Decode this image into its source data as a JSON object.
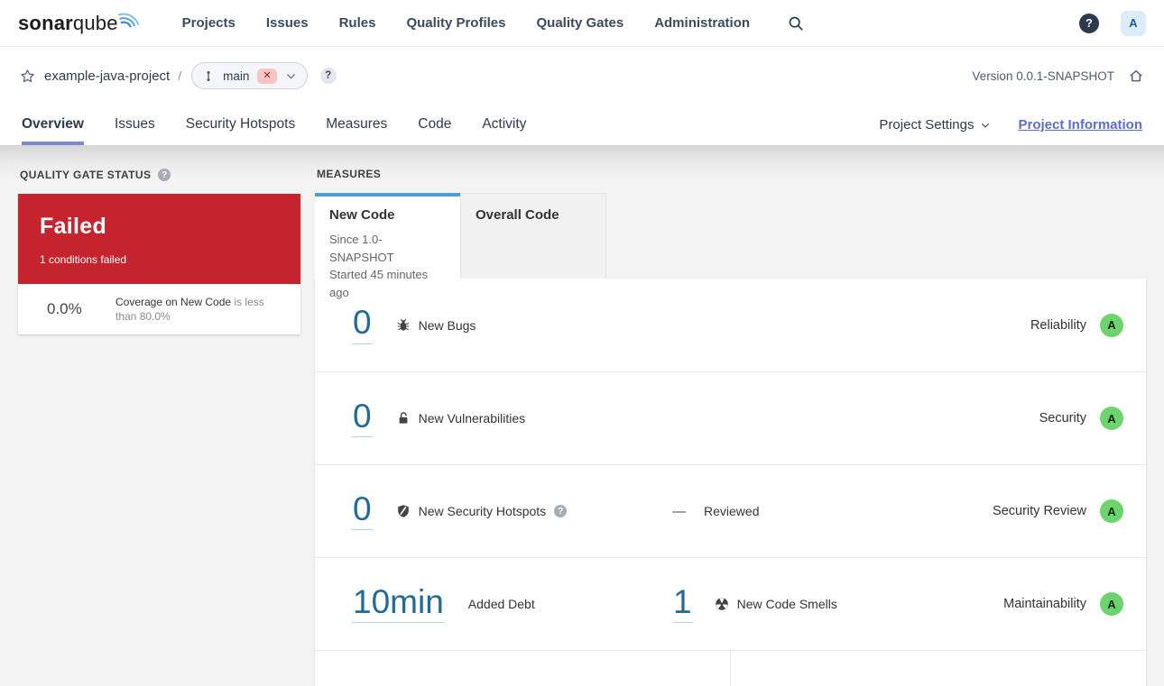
{
  "colors": {
    "accent_blue": "#4b9fd5",
    "link_blue": "#236a97",
    "failed_red": "#c5242e",
    "rating_a_green": "#6cd46c",
    "tab_underline": "#7b88d8",
    "project_info_link": "#5d6cd2"
  },
  "nav": {
    "logo_bold": "sonar",
    "logo_light": "qube",
    "items": [
      "Projects",
      "Issues",
      "Rules",
      "Quality Profiles",
      "Quality Gates",
      "Administration"
    ],
    "help_glyph": "?",
    "avatar": "A"
  },
  "breadcrumb": {
    "project": "example-java-project",
    "separator": "/",
    "branch": "main",
    "close_glyph": "✕",
    "help_glyph": "?",
    "version": "Version 0.0.1-SNAPSHOT"
  },
  "tabs": {
    "items": [
      "Overview",
      "Issues",
      "Security Hotspots",
      "Measures",
      "Code",
      "Activity"
    ],
    "active": "Overview",
    "project_settings": "Project Settings",
    "project_information": "Project Information"
  },
  "quality_gate": {
    "title": "QUALITY GATE STATUS",
    "help_glyph": "?",
    "status": "Failed",
    "conditions_text": "1 conditions failed",
    "condition_value": "0.0%",
    "condition_metric": "Coverage on New Code",
    "condition_rule": "is less than 80.0%"
  },
  "measures": {
    "title": "MEASURES",
    "new_code_tab": {
      "label": "New Code",
      "since": "Since 1.0-SNAPSHOT",
      "started": "Started 45 minutes ago"
    },
    "overall_tab": {
      "label": "Overall Code"
    },
    "rows": [
      {
        "value": "0",
        "label": "New Bugs",
        "rating_label": "Reliability",
        "rating": "A"
      },
      {
        "value": "0",
        "label": "New Vulnerabilities",
        "rating_label": "Security",
        "rating": "A"
      },
      {
        "value": "0",
        "label": "New Security Hotspots",
        "help_glyph": "?",
        "secondary_value": "—",
        "secondary_label": "Reviewed",
        "rating_label": "Security Review",
        "rating": "A"
      },
      {
        "value": "10min",
        "label": "Added Debt",
        "secondary_value": "1",
        "secondary_label": "New Code Smells",
        "rating_label": "Maintainability",
        "rating": "A"
      }
    ]
  }
}
